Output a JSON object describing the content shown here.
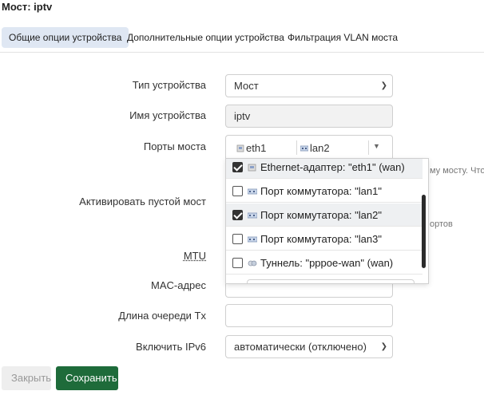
{
  "page": {
    "title": "Мост: iptv"
  },
  "tabs": [
    {
      "label": "Общие опции устройства",
      "active": true
    },
    {
      "label": "Дополнительные опции устройства",
      "active": false
    },
    {
      "label": "Фильтрация VLAN моста",
      "active": false
    }
  ],
  "form": {
    "device_type": {
      "label": "Тип устройства",
      "value": "Мост"
    },
    "device_name": {
      "label": "Имя устройства",
      "value": "iptv"
    },
    "bridge_ports": {
      "label": "Порты моста",
      "chips": [
        "eth1",
        "lan2"
      ]
    },
    "empty_bridge": {
      "label": "Активировать пустой мост"
    },
    "mtu": {
      "label": "MTU"
    },
    "mac": {
      "label": "MAC-адрес"
    },
    "tx_queue": {
      "label": "Длина очереди Tx"
    },
    "ipv6": {
      "label": "Включить IPv6",
      "value": "автоматически (отключено)"
    }
  },
  "dropdown": {
    "options": [
      {
        "label": "Ethernet-адаптер: \"eth1\" (wan)",
        "checked": true,
        "icon": "ethernet-icon"
      },
      {
        "label": "Порт коммутатора: \"lan1\"",
        "checked": false,
        "icon": "switch-icon"
      },
      {
        "label": "Порт коммутатора: \"lan2\"",
        "checked": true,
        "icon": "switch-icon"
      },
      {
        "label": "Порт коммутатора: \"lan3\"",
        "checked": false,
        "icon": "switch-icon"
      },
      {
        "label": "Туннель: \"pppoe-wan\" (wan)",
        "checked": false,
        "icon": "tunnel-icon"
      }
    ]
  },
  "hints": {
    "ports_hint": "му мосту. Чтоб",
    "empty_hint": "ортов"
  },
  "buttons": {
    "close": "Закрыть",
    "save": "Сохранить"
  },
  "colors": {
    "save_bg": "#1e6b3a",
    "active_tab_bg": "#dfe7f3",
    "scrollbar": "#2b2b2b"
  }
}
